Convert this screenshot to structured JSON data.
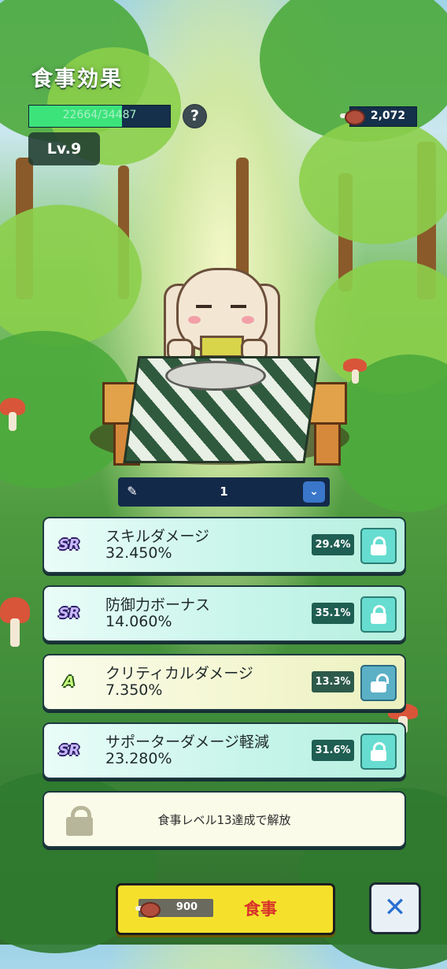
{
  "header": {
    "title": "食事効果",
    "xp_text": "22664/34487",
    "xp_progress": 0.657,
    "help_label": "?",
    "level": "Lv.9"
  },
  "currency": {
    "icon": "meat-icon",
    "amount": "2,072"
  },
  "selector": {
    "icon": "pencil-icon",
    "value": "1",
    "dropdown_icon": "chevron-down-icon",
    "dropdown_glyph": "⌄"
  },
  "effects": [
    {
      "rank": "SR",
      "name": "スキルダメージ",
      "value": "32.450%",
      "chance": "29.4%",
      "lock": "locked"
    },
    {
      "rank": "SR",
      "name": "防御力ボーナス",
      "value": "14.060%",
      "chance": "35.1%",
      "lock": "locked"
    },
    {
      "rank": "A",
      "name": "クリティカルダメージ",
      "value": "7.350%",
      "chance": "13.3%",
      "lock": "unlocked"
    },
    {
      "rank": "SR",
      "name": "サポーターダメージ軽減",
      "value": "23.280%",
      "chance": "31.6%",
      "lock": "locked"
    }
  ],
  "locked_slot": {
    "message": "食事レベル13達成で解放"
  },
  "footer": {
    "cost": "900",
    "eat_label": "食事",
    "close_glyph": "✕"
  },
  "colors": {
    "accent_yellow": "#f5e12c",
    "xp_green": "#3ce37a",
    "sr_card": "#c8f5ea",
    "a_card": "#f3f6cf"
  }
}
